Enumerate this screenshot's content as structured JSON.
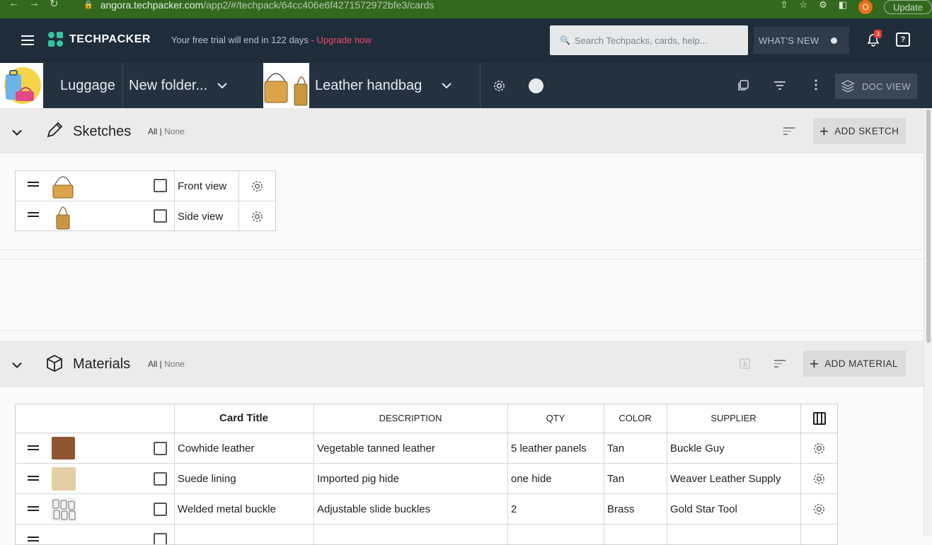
{
  "browser": {
    "url_host": "angora.techpacker.com",
    "url_path": "/app2/#/techpack/64cc406e6f4271572972bfe3/cards",
    "profile_initial": "O",
    "update_label": "Update"
  },
  "topbar": {
    "logo_text": "TECHPACKER",
    "trial_text": "Your free trial will end in 122 days",
    "upgrade_text": " - Upgrade now",
    "search_placeholder": "Search Techpacks, cards, help...",
    "whats_new_label": "WHAT'S NEW",
    "notification_count": "3",
    "help_label": "?"
  },
  "breadcrumb": {
    "category": "Luggage",
    "folder": "New folder...",
    "product": "Leather handbag",
    "doc_view_label": "DOC VIEW"
  },
  "sketches": {
    "title": "Sketches",
    "filter_all": "All |",
    "filter_none": "None",
    "add_label": "ADD SKETCH",
    "rows": [
      {
        "label": "Front view"
      },
      {
        "label": "Side view"
      }
    ]
  },
  "materials": {
    "title": "Materials",
    "filter_all": "All |",
    "filter_none": "None",
    "add_label": "ADD MATERIAL",
    "columns": {
      "title": "Card Title",
      "description": "DESCRIPTION",
      "qty": "QTY",
      "color": "COLOR",
      "supplier": "SUPPLIER"
    },
    "rows": [
      {
        "title": "Cowhide leather",
        "description": "Vegetable tanned leather",
        "qty": "5 leather panels",
        "color": "Tan",
        "supplier": "Buckle Guy"
      },
      {
        "title": "Suede lining",
        "description": "Imported pig hide",
        "qty": "one hide",
        "color": "Tan",
        "supplier": "Weaver Leather Supply"
      },
      {
        "title": "Welded metal buckle",
        "description": "Adjustable slide buckles",
        "qty": "2",
        "color": "Brass",
        "supplier": "Gold Star Tool"
      }
    ]
  },
  "colors": {
    "topbar_bg": "#1f2d3a",
    "accent_teal": "#33c3a6",
    "upgrade_red": "#ef4a6b",
    "browser_green": "#33691e"
  }
}
